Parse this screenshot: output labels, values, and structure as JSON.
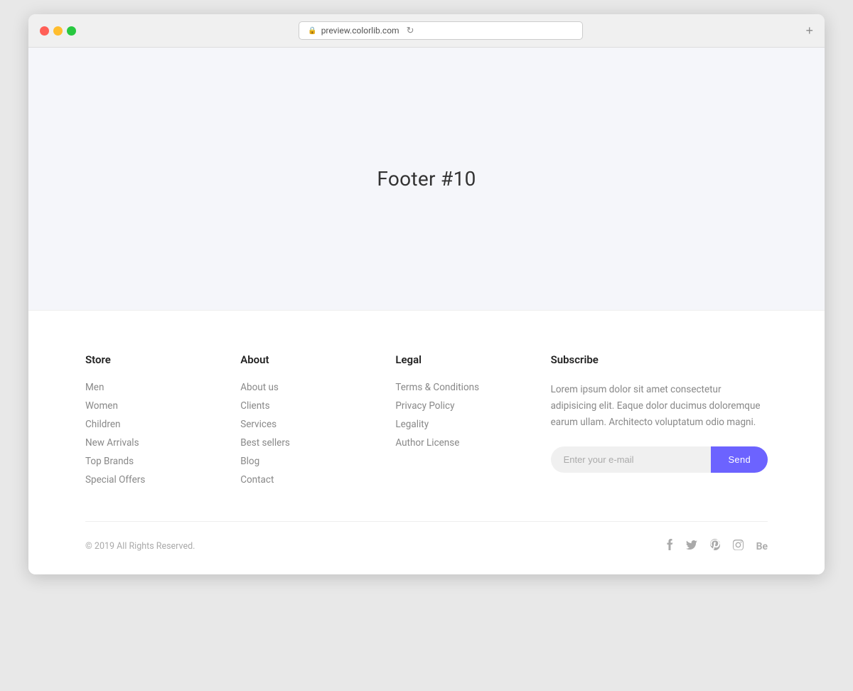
{
  "browser": {
    "url": "preview.colorlib.com",
    "new_tab_label": "+"
  },
  "page": {
    "title": "Footer #10"
  },
  "footer": {
    "columns": {
      "store": {
        "heading": "Store",
        "links": [
          "Men",
          "Women",
          "Children",
          "New Arrivals",
          "Top Brands",
          "Special Offers"
        ]
      },
      "about": {
        "heading": "About",
        "links": [
          "About us",
          "Clients",
          "Services",
          "Best sellers",
          "Blog",
          "Contact"
        ]
      },
      "legal": {
        "heading": "Legal",
        "links": [
          "Terms & Conditions",
          "Privacy Policy",
          "Legality",
          "Author License"
        ]
      },
      "subscribe": {
        "heading": "Subscribe",
        "description": "Lorem ipsum dolor sit amet consectetur adipisicing elit. Eaque dolor ducimus doloremque earum ullam. Architecto voluptatum odio magni.",
        "email_placeholder": "Enter your e-mail",
        "send_label": "Send"
      }
    },
    "bottom": {
      "copyright": "© 2019 All Rights Reserved.",
      "social_icons": [
        "facebook",
        "twitter",
        "pinterest",
        "instagram",
        "behance"
      ]
    }
  }
}
